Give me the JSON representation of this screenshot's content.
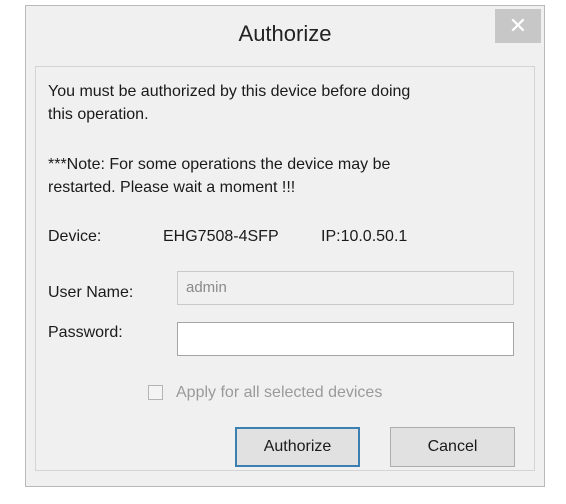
{
  "dialog": {
    "title": "Authorize",
    "close_label": "✕"
  },
  "message": {
    "line1": "You must be authorized by this device before doing",
    "line2": "this operation.",
    "note_line1": "***Note: For some operations the device may be",
    "note_line2": "restarted. Please wait a moment !!!"
  },
  "device": {
    "label": "Device:",
    "name": "EHG7508-4SFP",
    "ip": "IP:10.0.50.1"
  },
  "form": {
    "username_label": "User Name:",
    "username_value": "admin",
    "password_label": "Password:",
    "password_value": "",
    "apply_all_label": "Apply for all selected devices",
    "apply_all_checked": false
  },
  "buttons": {
    "authorize": "Authorize",
    "cancel": "Cancel"
  }
}
